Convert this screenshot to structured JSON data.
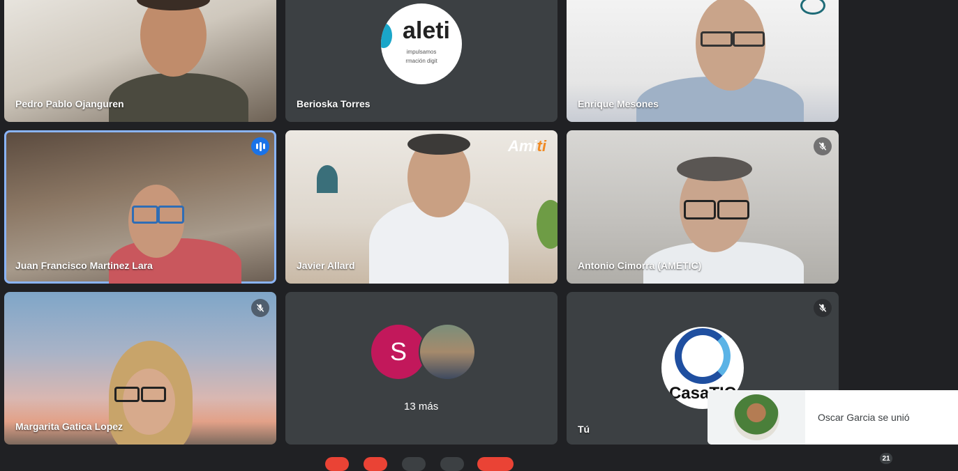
{
  "participants": [
    {
      "name": "Pedro Pablo Ojanguren",
      "muted": false
    },
    {
      "name": "Berioska Torres",
      "muted": false,
      "logo_text": "aleti",
      "logo_tagline_1": "impulsamos",
      "logo_tagline_2": "rmación digit"
    },
    {
      "name": "Enrique Mesones",
      "muted": false
    },
    {
      "name": "Juan Francisco Martinez Lara",
      "muted": false,
      "speaking": true
    },
    {
      "name": "Javier Allard",
      "muted": false,
      "watermark": "Ami",
      "watermark_accent": "ti"
    },
    {
      "name": "Antonio Cimorra (AMETIC)",
      "muted": true
    },
    {
      "name": "Margarita Gatica Lopez",
      "muted": true
    },
    {
      "overflow_label": "13 más",
      "initial": "S"
    },
    {
      "name": "Tú",
      "muted": true,
      "logo_text": "CasaTIC"
    }
  ],
  "notification": {
    "text": "Oscar Garcia se unió"
  },
  "controls": {
    "participant_count": "21"
  },
  "colors": {
    "background": "#202124",
    "tile": "#3c4043",
    "active_border": "#8ab4f8",
    "speaking": "#1a73e8",
    "avatar": "#c2185b",
    "end_call": "#ea4335"
  }
}
